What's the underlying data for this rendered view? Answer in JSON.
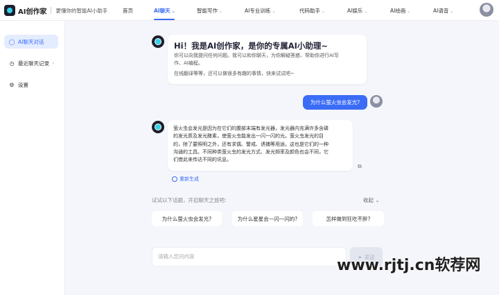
{
  "brand": {
    "name": "AI创作家",
    "slogan": "更懂你的智能AI小助手"
  },
  "nav": [
    {
      "label": "首页",
      "caret": ""
    },
    {
      "label": "AI聊天",
      "caret": "⌄"
    },
    {
      "label": "智能写作",
      "caret": "⌄"
    },
    {
      "label": "AI专业训练",
      "caret": "⌄"
    },
    {
      "label": "代码助手",
      "caret": "⌄"
    },
    {
      "label": "AI娱乐",
      "caret": "⌄"
    },
    {
      "label": "AI绘画",
      "caret": "⌄"
    },
    {
      "label": "AI语音",
      "caret": "⌄"
    }
  ],
  "colors": {
    "accent": "#3b6cf6",
    "background": "#f5f6fb"
  },
  "sidebar": {
    "items": [
      {
        "label": "AI聊天对话",
        "icon": "chat-icon"
      },
      {
        "label": "最近聊天记录",
        "icon": "clock-icon"
      },
      {
        "label": "设置",
        "icon": "gear-icon"
      }
    ]
  },
  "welcome": {
    "title": "Hi！我是AI创作家，是你的专属AI小助理~",
    "line1": "你可以向我提问任何问题。我可以和你聊天，为你解疑答惑、帮助你进行AI写",
    "line2": "作、AI编程。",
    "line3": "在线翻译等等，还可以做很多有趣的事情，快来试试吧~"
  },
  "user_message": "为什么萤火虫会发光?",
  "answer": {
    "line1": "萤火虫会发光是因为在它们的腹部末端有发光器，发光器内充满许多含磷",
    "line2": "的发光质及发光酵素，使萤火虫能发出一闪一闪的光。萤火虫发光的目",
    "line3": "的，除了要照明之外，还有求偶、警戒、诱捕等用途。这也是它们的一种",
    "line4": "沟通的工具。不同种类萤火虫的发光方式、发光频率及颜色也会不同，它",
    "line5": "们借此来传达不同的讯息。"
  },
  "regenerate_label": "重新生成",
  "suggestions": {
    "title": "试试以下话题，开启聊天之旅吧:",
    "collapse_label": "收起",
    "items": [
      "为什么萤火虫会发光?",
      "为什么星星会一闪一闪的?",
      "怎样做到狂吃不胖?"
    ]
  },
  "input": {
    "placeholder": "请输入您问内容",
    "value": ""
  },
  "send_label": "发送",
  "watermark": "www.rjtj.cn软荐网"
}
